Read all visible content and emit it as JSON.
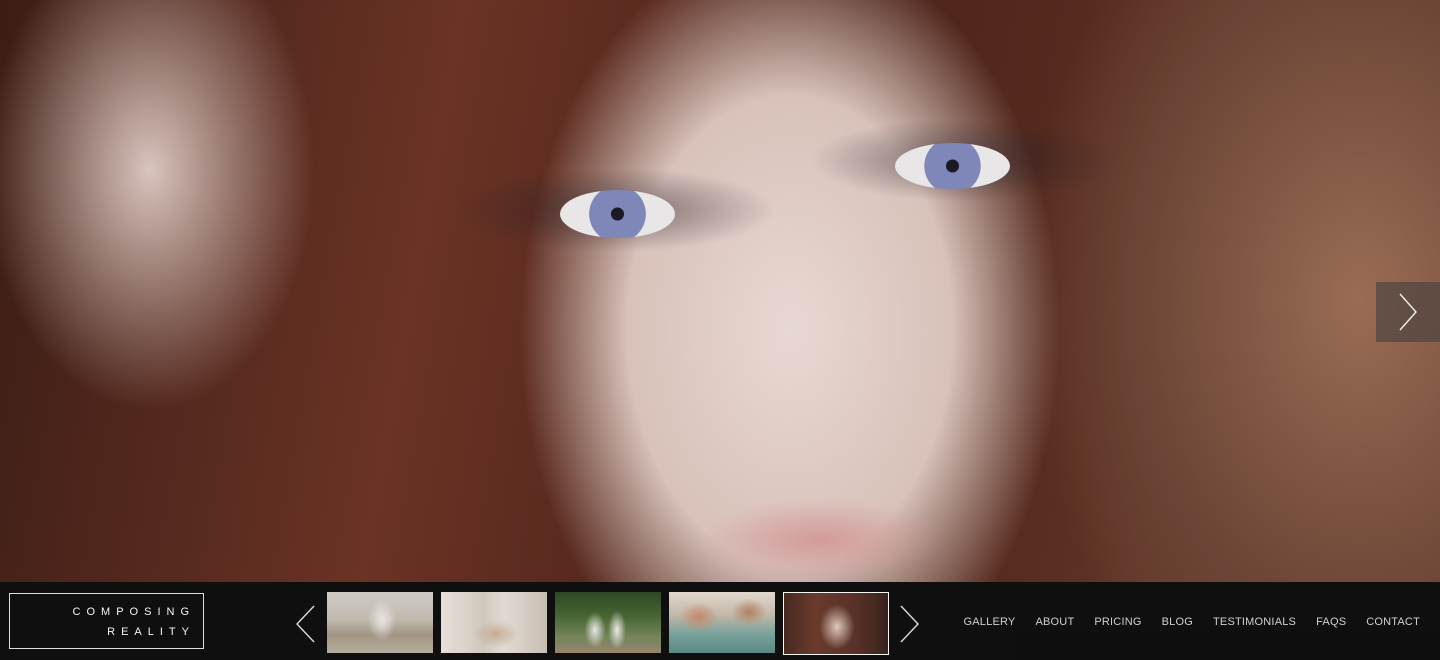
{
  "hero": {
    "image": "portrait-close-up-woman-red-hair-blue-eyes",
    "next_icon": "chevron-right-icon"
  },
  "logo": {
    "line1": "COMPOSING",
    "line2": "REALITY"
  },
  "thumbnails": {
    "prev_icon": "chevron-left-icon",
    "next_icon": "chevron-right-icon",
    "items": [
      {
        "subject": "bride-and-groom-embrace"
      },
      {
        "subject": "hands-holding"
      },
      {
        "subject": "couple-in-garden"
      },
      {
        "subject": "women-with-flowers"
      },
      {
        "subject": "portrait-close-up",
        "active": true
      }
    ]
  },
  "nav": {
    "items": [
      "GALLERY",
      "ABOUT",
      "PRICING",
      "BLOG",
      "TESTIMONIALS",
      "FAQS",
      "CONTACT"
    ]
  },
  "colors": {
    "bar_background": "#0f0f0f",
    "nav_text": "#d8d8d8",
    "logo_border": "#e6e6e6"
  }
}
